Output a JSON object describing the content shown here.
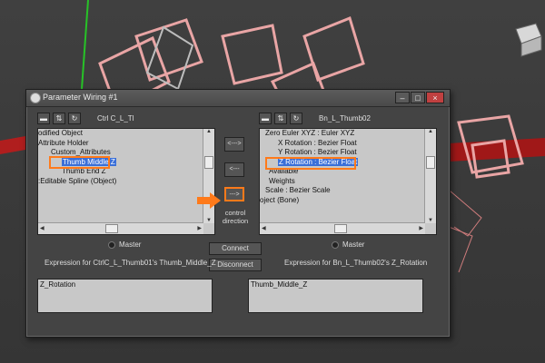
{
  "dialog": {
    "title": "Parameter Wiring #1",
    "window_buttons": [
      "–",
      "□",
      "×"
    ]
  },
  "left": {
    "object_name": "Ctrl C_L_Tl",
    "tree": [
      {
        "text": "odified Object",
        "selected": false
      },
      {
        "text": "Attribute Holder",
        "selected": false
      },
      {
        "text": "Custom_Attributes",
        "selected": false
      },
      {
        "text": "Thumb Middle Z",
        "selected": true
      },
      {
        "text": "Thumb End Z",
        "selected": false
      },
      {
        "text": ":Editable Spline (Object)",
        "selected": false
      }
    ],
    "radio_label": "Master",
    "expression_label": "Expression for CtrlC_L_Thumb01's Thumb_Middle_Z",
    "expression": "Z_Rotation"
  },
  "right": {
    "object_name": "Bn_L_Thumb02",
    "tree": [
      {
        "text": "Zero Euler XYZ : Euler XYZ",
        "selected": false
      },
      {
        "text": "X Rotation : Bezier Float",
        "selected": false
      },
      {
        "text": "Y Rotation : Bezier Float",
        "selected": false
      },
      {
        "text": "Z Rotation : Bezier Float",
        "selected": true
      },
      {
        "text": "Available",
        "selected": false
      },
      {
        "text": "Weights",
        "selected": false
      },
      {
        "text": "Scale : Bezier Scale",
        "selected": false
      },
      {
        "text": "oject (Bone)",
        "selected": false
      }
    ],
    "radio_label": "Master",
    "expression_label": "Expression for Bn_L_Thumb02's Z_Rotation",
    "expression": "Thumb_Middle_Z"
  },
  "middle": {
    "btn_left_right": "<--->",
    "btn_left": "<---",
    "btn_right": "--->",
    "control_direction": "control direction",
    "connect": "Connect",
    "disconnect": "Disconnect"
  },
  "colors": {
    "highlight": "#ff7a1a",
    "selection": "#3a6fd8"
  }
}
